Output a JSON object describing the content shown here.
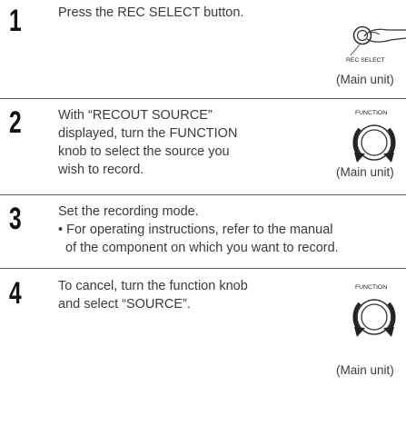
{
  "steps": [
    {
      "number": "1",
      "lines": [
        "Press the REC SELECT button."
      ],
      "icon_label": "REC SELECT",
      "caption": "(Main unit)"
    },
    {
      "number": "2",
      "lines": [
        "With “RECOUT SOURCE”",
        "displayed, turn the FUNCTION",
        "knob to select the source you",
        "wish to record."
      ],
      "icon_label": "FUNCTION",
      "caption": "(Main unit)"
    },
    {
      "number": "3",
      "lines": [
        "Set the recording mode.",
        "• For operating instructions, refer to the manual",
        "  of the component on which you want to record."
      ]
    },
    {
      "number": "4",
      "lines": [
        "To cancel, turn the function knob",
        "and select “SOURCE”."
      ],
      "icon_label": "FUNCTION",
      "caption": "(Main unit)"
    }
  ]
}
